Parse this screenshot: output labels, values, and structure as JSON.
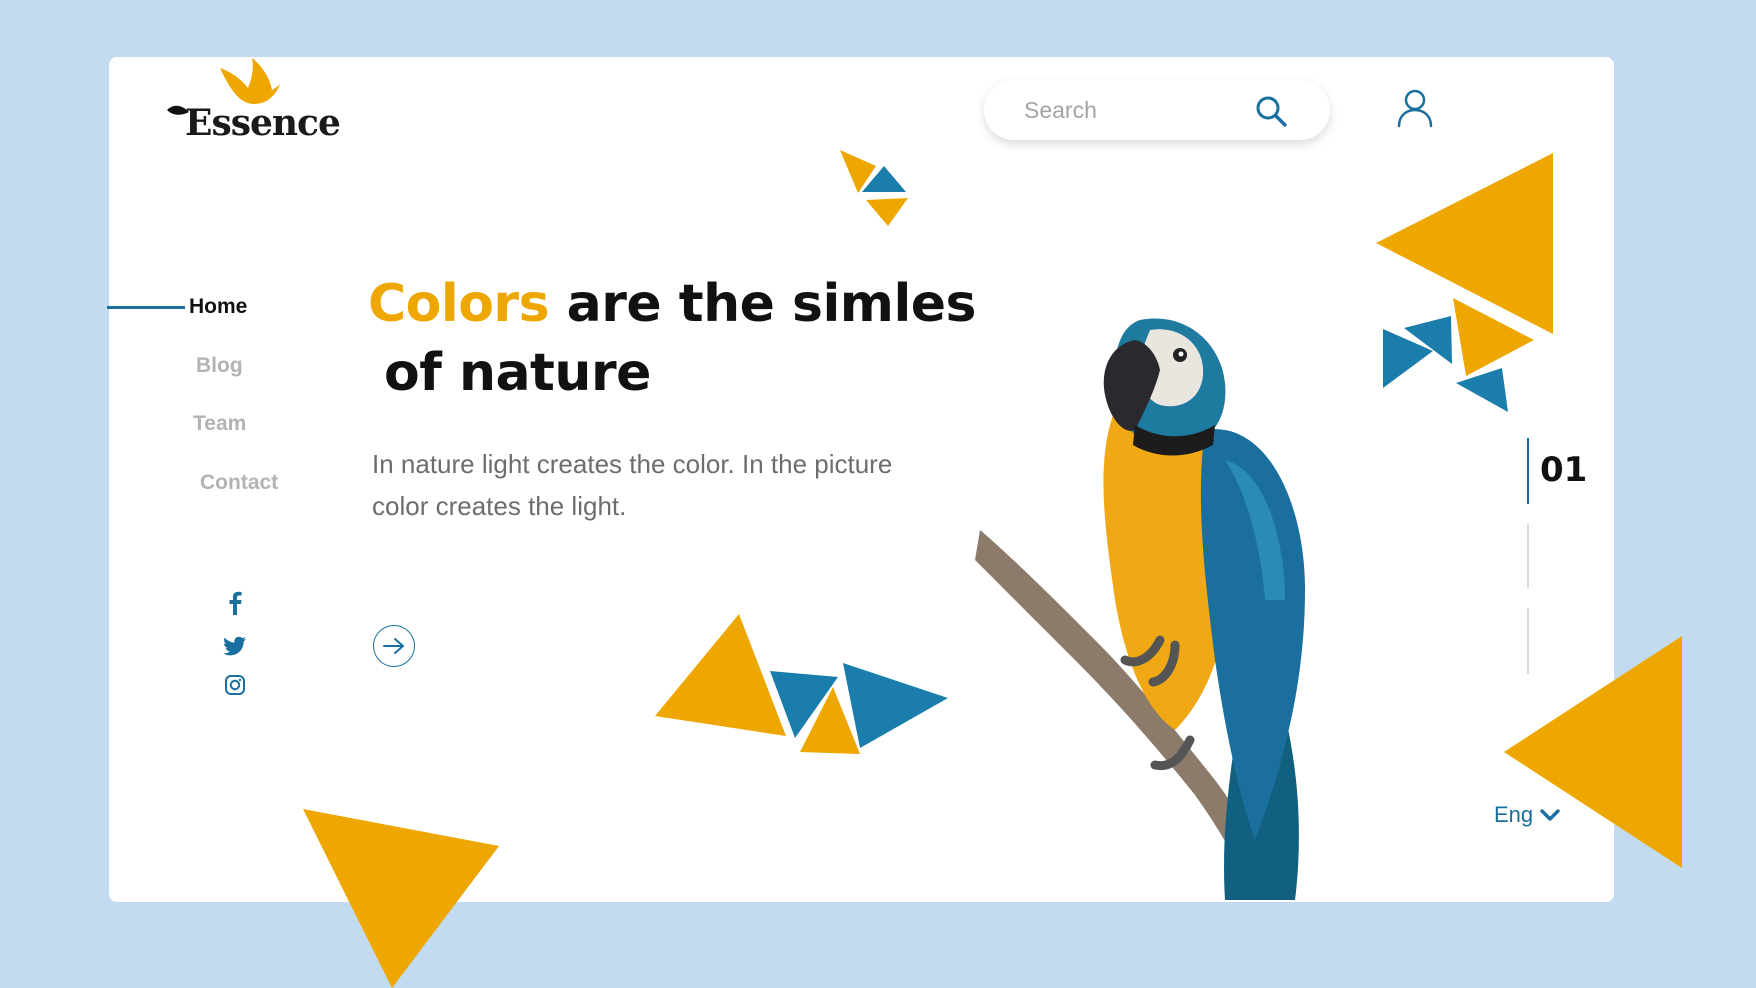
{
  "brand": {
    "name": "Essence",
    "colors": {
      "accent": "#eea600",
      "primary": "#1a6f9f",
      "background": "#c3dbf0"
    }
  },
  "header": {
    "search": {
      "placeholder": "Search",
      "value": "",
      "icon": "search-icon"
    },
    "user_icon": "user-icon"
  },
  "nav": {
    "items": [
      {
        "label": "Home",
        "active": true
      },
      {
        "label": "Blog",
        "active": false
      },
      {
        "label": "Team",
        "active": false
      },
      {
        "label": "Contact",
        "active": false
      }
    ]
  },
  "social": [
    {
      "icon": "facebook-icon"
    },
    {
      "icon": "twitter-icon"
    },
    {
      "icon": "instagram-icon"
    }
  ],
  "hero": {
    "headline_accent": "Colors",
    "headline_rest": " are the simles",
    "headline_line2": "of nature",
    "description": "In nature light creates the color. In the picture color creates the light.",
    "cta_icon": "arrow-right-icon"
  },
  "slider": {
    "current": "01",
    "total_indicators": 3,
    "active_index": 0
  },
  "language": {
    "label": "Eng",
    "icon": "chevron-down-icon"
  }
}
